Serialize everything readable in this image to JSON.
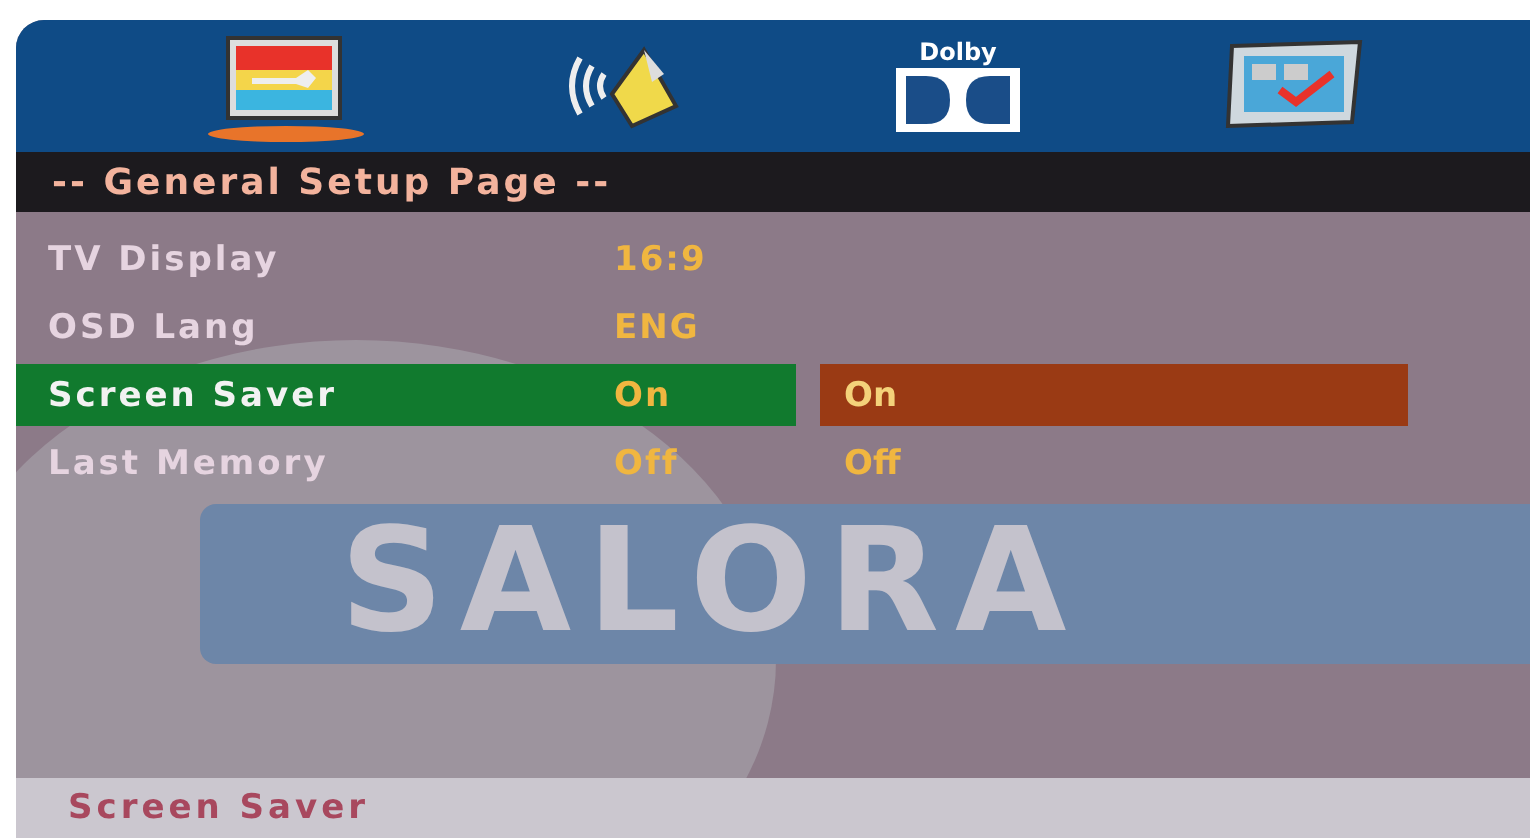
{
  "tabs": [
    {
      "kind": "general",
      "selected": true
    },
    {
      "kind": "audio",
      "selected": false
    },
    {
      "kind": "dolby",
      "label": "Dolby",
      "selected": false
    },
    {
      "kind": "preference",
      "selected": false
    }
  ],
  "page_title": "-- General Setup Page --",
  "background_logo": "SALORA",
  "rows": [
    {
      "label": "TV Display",
      "value": "16:9",
      "selected": false
    },
    {
      "label": "OSD Lang",
      "value": "ENG",
      "selected": false
    },
    {
      "label": "Screen Saver",
      "value": "On",
      "selected": true
    },
    {
      "label": "Last Memory",
      "value": "Off",
      "selected": false
    }
  ],
  "options": [
    {
      "label": "On",
      "selected": true
    },
    {
      "label": "Off",
      "selected": false
    }
  ],
  "status_bar": "Screen Saver"
}
